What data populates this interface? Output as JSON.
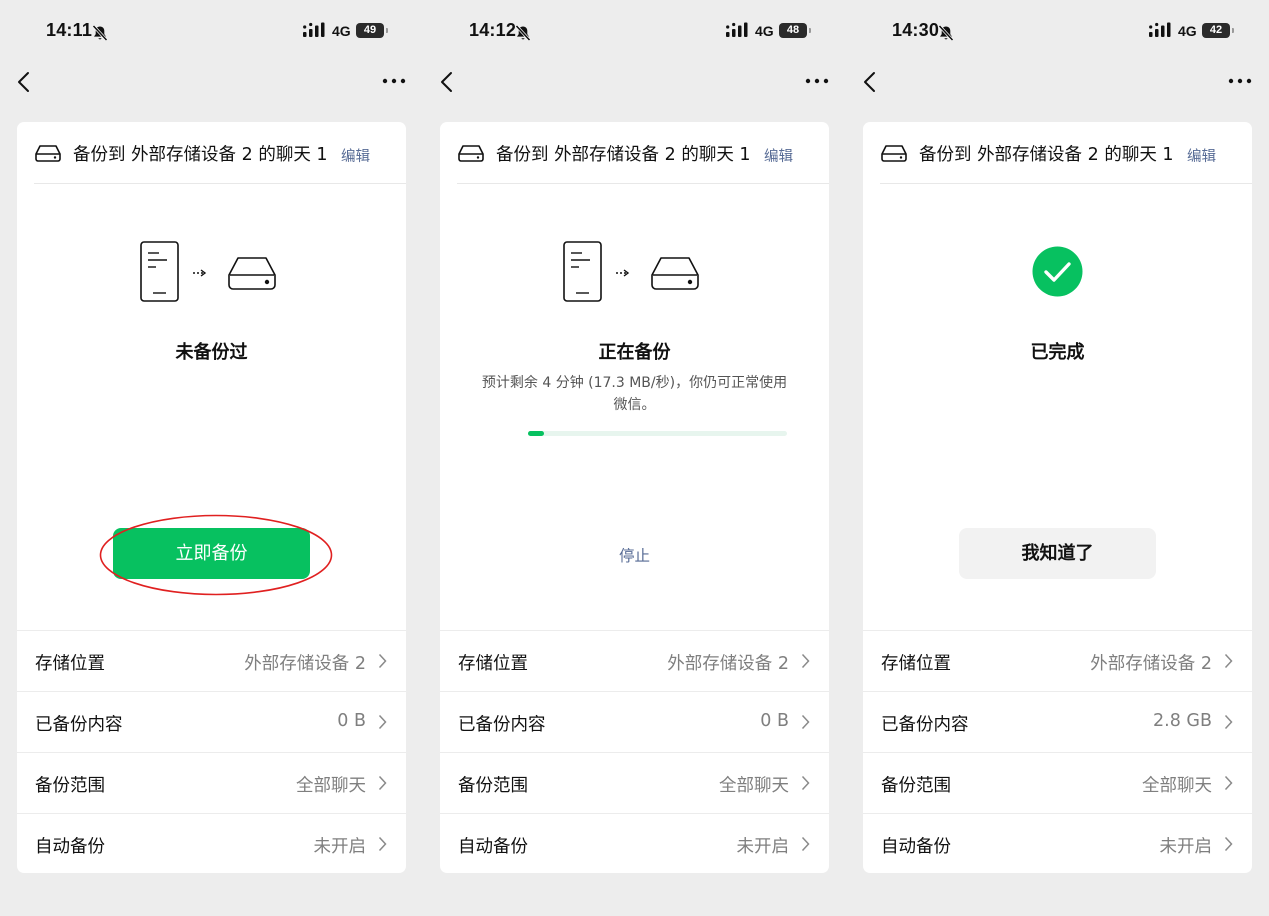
{
  "screens": [
    {
      "status": {
        "time": "14:11",
        "network": "4G",
        "battery": "49"
      },
      "card_title": "备份到 外部存储设备 2 的聊天 1",
      "edit_label": "编辑",
      "state_label": "未备份过",
      "primary_button": "立即备份",
      "rows": [
        {
          "label": "存储位置",
          "value": "外部存储设备 2"
        },
        {
          "label": "已备份内容",
          "value": "0 B"
        },
        {
          "label": "备份范围",
          "value": "全部聊天"
        },
        {
          "label": "自动备份",
          "value": "未开启"
        }
      ]
    },
    {
      "status": {
        "time": "14:12",
        "network": "4G",
        "battery": "48"
      },
      "card_title": "备份到 外部存储设备 2 的聊天 1",
      "edit_label": "编辑",
      "state_label": "正在备份",
      "state_sub": "预计剩余 4 分钟 (17.3 MB/秒)，你仍可正常使用微信。",
      "progress": 0.06,
      "stop_link": "停止",
      "rows": [
        {
          "label": "存储位置",
          "value": "外部存储设备 2"
        },
        {
          "label": "已备份内容",
          "value": "0 B"
        },
        {
          "label": "备份范围",
          "value": "全部聊天"
        },
        {
          "label": "自动备份",
          "value": "未开启"
        }
      ]
    },
    {
      "status": {
        "time": "14:30",
        "network": "4G",
        "battery": "42"
      },
      "card_title": "备份到 外部存储设备 2 的聊天 1",
      "edit_label": "编辑",
      "state_label": "已完成",
      "done_button": "我知道了",
      "rows": [
        {
          "label": "存储位置",
          "value": "外部存储设备 2"
        },
        {
          "label": "已备份内容",
          "value": "2.8 GB"
        },
        {
          "label": "备份范围",
          "value": "全部聊天"
        },
        {
          "label": "自动备份",
          "value": "未开启"
        }
      ]
    }
  ],
  "colors": {
    "accent": "#07c160",
    "link": "#576b95",
    "annotation": "#e02020",
    "background": "#ededed"
  },
  "icons": [
    "bell-off-icon",
    "signal-icon",
    "battery-icon",
    "back-chevron-icon",
    "more-icon",
    "hard-drive-icon",
    "phone-icon",
    "arrow-right-icon",
    "check-circle-icon",
    "chevron-right-icon"
  ]
}
